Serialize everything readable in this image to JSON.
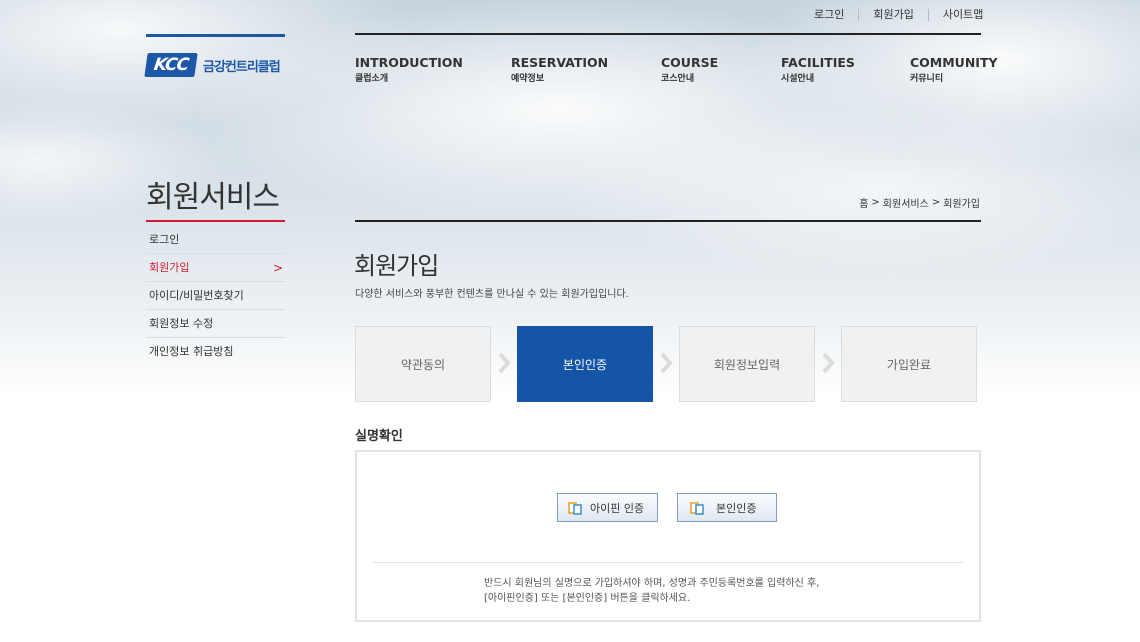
{
  "utility": [
    "로그인",
    "회원가입",
    "사이트맵"
  ],
  "brand": {
    "mark": "KCC",
    "name": "금강컨트리클럽"
  },
  "gnb": [
    {
      "en": "INTRODUCTION",
      "ko": "클럽소개"
    },
    {
      "en": "RESERVATION",
      "ko": "예약정보"
    },
    {
      "en": "COURSE",
      "ko": "코스안내"
    },
    {
      "en": "FACILITIES",
      "ko": "시설안내"
    },
    {
      "en": "COMMUNITY",
      "ko": "커뮤니티"
    }
  ],
  "lnb": {
    "title": "회원서비스",
    "items": [
      "로그인",
      "회원가입",
      "아이디/비밀번호찾기",
      "회원정보 수정",
      "개인정보 취급방침"
    ],
    "active_chevron": ">"
  },
  "breadcrumb": [
    "홈",
    "회원서비스",
    "회원가입"
  ],
  "breadcrumb_sep": ">",
  "page": {
    "title": "회원가입",
    "description": "다양한 서비스와 풍부한 컨텐츠를 만나실 수 있는 회원가입입니다."
  },
  "steps": [
    "약관동의",
    "본인인증",
    "회원정보입력",
    "가입완료"
  ],
  "section": {
    "title": "실명확인",
    "buttons": [
      "아이핀 인증",
      "본인인증"
    ],
    "note_line1": "반드시 회원님의 실명으로 가입하셔야 하며, 성명과 주민등록번호를 입력하신 후,",
    "note_line2": "[아이핀인증] 또는 [본인인증] 버튼을 클릭하세요."
  },
  "colors": {
    "brand_blue": "#1d57a8",
    "active_step": "#1455a8",
    "accent_red": "#d7192f"
  }
}
